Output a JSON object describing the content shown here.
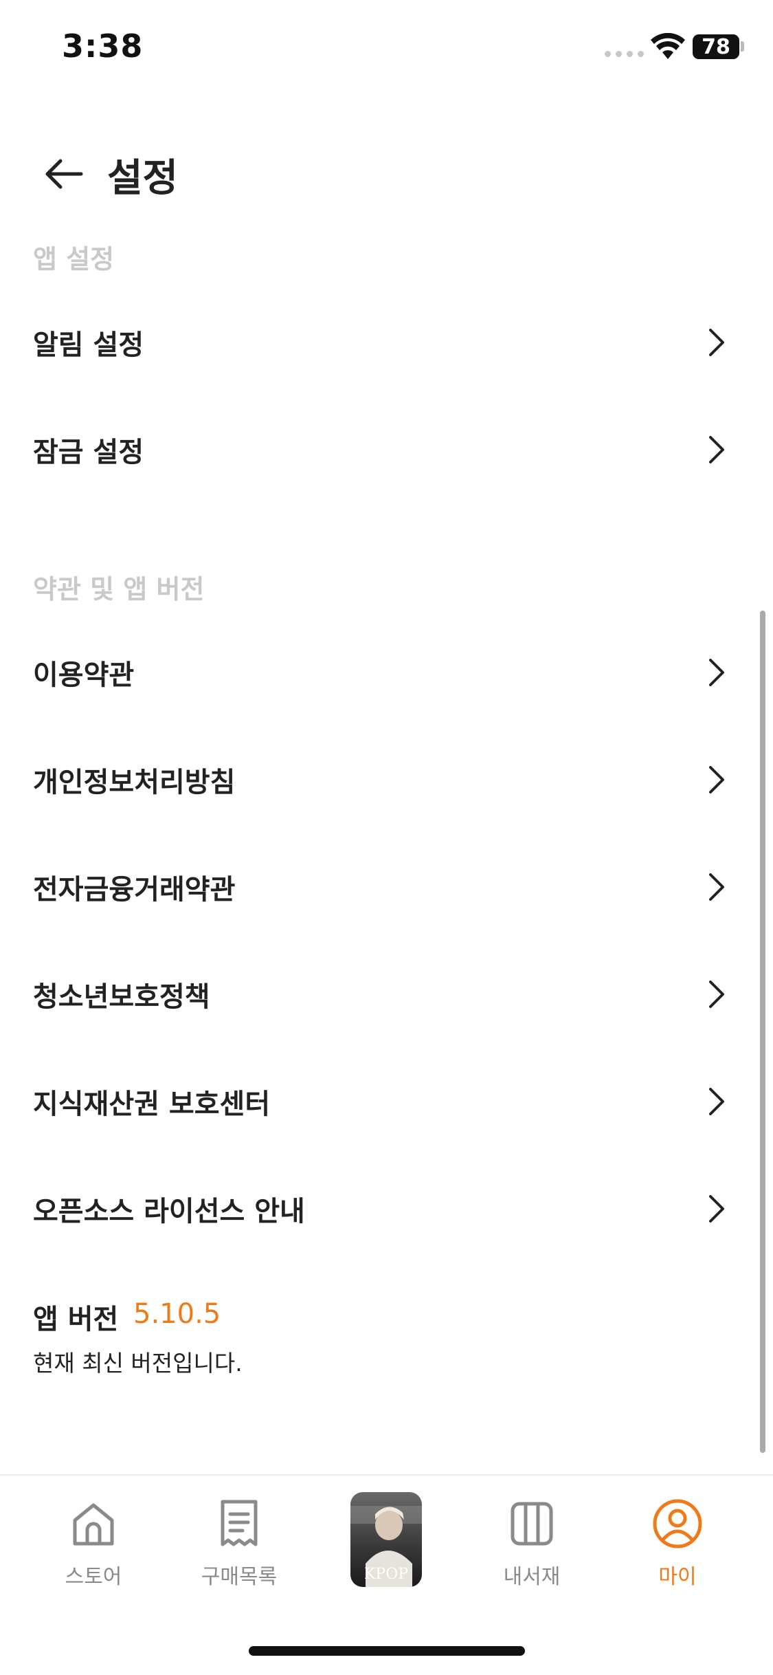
{
  "status_bar": {
    "time": "3:38",
    "battery": "78"
  },
  "header": {
    "title": "설정",
    "back_icon": "arrow-left-icon"
  },
  "sections": {
    "app_settings": {
      "label": "앱 설정",
      "items": [
        {
          "label": "알림 설정"
        },
        {
          "label": "잠금 설정"
        }
      ]
    },
    "terms": {
      "label": "약관 및 앱 버전",
      "items": [
        {
          "label": "이용약관"
        },
        {
          "label": "개인정보처리방침"
        },
        {
          "label": "전자금융거래약관"
        },
        {
          "label": "청소년보호정책"
        },
        {
          "label": "지식재산권 보호센터"
        },
        {
          "label": "오픈소스 라이선스 안내"
        }
      ]
    }
  },
  "version": {
    "title": "앱 버전",
    "number": "5.10.5",
    "description": "현재 최신 버전입니다."
  },
  "tab_bar": {
    "tabs": [
      {
        "label": "스토어",
        "icon": "home-icon"
      },
      {
        "label": "구매목록",
        "icon": "receipt-icon"
      },
      {
        "label": "",
        "icon": "book-cover-thumbnail",
        "cover_text": "KPOP"
      },
      {
        "label": "내서재",
        "icon": "bookshelf-icon"
      },
      {
        "label": "마이",
        "icon": "profile-icon"
      }
    ],
    "active_index": 4
  },
  "colors": {
    "accent": "#ef7a1a",
    "section_label": "#c9c9c9",
    "text": "#222222",
    "tab_inactive": "#8a8a8a"
  }
}
